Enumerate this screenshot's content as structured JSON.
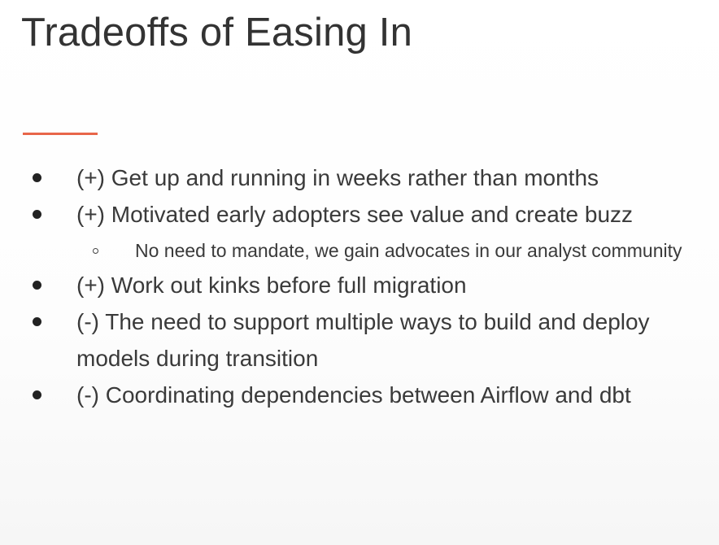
{
  "slide": {
    "title": "Tradeoffs of Easing In",
    "accent_color": "#e8664a",
    "bullets": [
      {
        "text": "(+) Get up and running in weeks rather than months"
      },
      {
        "text": "(+) Motivated early adopters see value and create buzz",
        "sub": [
          {
            "text": "No need to mandate, we gain advocates in our analyst community"
          }
        ]
      },
      {
        "text": "(+) Work out kinks before full migration"
      },
      {
        "text": "(-) The need to support multiple ways to build and deploy models during transition"
      },
      {
        "text": "(-) Coordinating dependencies between Airflow and dbt"
      }
    ]
  }
}
